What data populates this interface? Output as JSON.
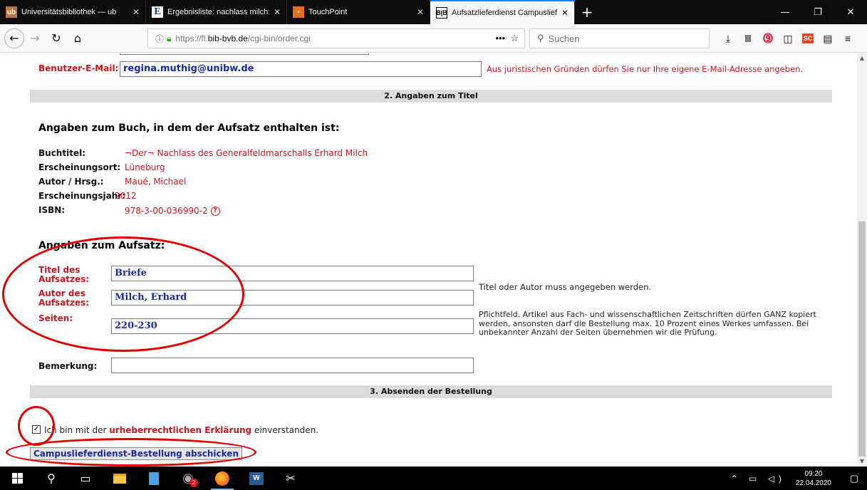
{
  "browser": {
    "tabs": [
      {
        "favicon": "ub",
        "title": "Universitätsbibliothek — ub",
        "active": false
      },
      {
        "favicon": "e",
        "title": "Ergebnisliste: nachlass milch: C",
        "active": false
      },
      {
        "favicon": "touchpoint",
        "title": "TouchPoint",
        "active": false
      },
      {
        "favicon": "bib",
        "title": "Aufsatzlieferdienst Campuslief",
        "active": true
      }
    ],
    "new_tab_icon": "plus-icon",
    "url_prefix": "https://fl.",
    "url_domain": "bib-bvb.de",
    "url_path": "/cgi-bin/order.cgi",
    "url_dots": "•••",
    "search_placeholder": "Suchen",
    "sc_label": "SC"
  },
  "form": {
    "email_label": "Benutzer-E-Mail:",
    "email_value": "regina.muthig@unibw.de",
    "email_note": "Aus juristischen Gründen dürfen Sie nur Ihre eigene E-Mail-Adresse angeben.",
    "section2_title": "2. Angaben zum Titel",
    "book_heading": "Angaben zum Buch, in dem der Aufsatz enthalten ist:",
    "book_fields": [
      {
        "label": "Buchtitel:",
        "value": "¬Der¬ Nachlass des Generalfeldmarschalls Erhard Milch"
      },
      {
        "label": "Erscheinungsort:",
        "value": "Lüneburg"
      },
      {
        "label": "Autor / Hrsg.:",
        "value": "Maué, Michael"
      },
      {
        "label": "Erscheinungsjahr:",
        "value": "2012"
      },
      {
        "label": "ISBN:",
        "value": "978-3-00-036990-2"
      }
    ],
    "isbn_icon_glyph": "?",
    "article_heading": "Angaben zum Aufsatz:",
    "article_title_label_1": "Titel des",
    "article_title_label_2": "Aufsatzes:",
    "article_title_value": "Briefe",
    "article_author_label_1": "Autor des",
    "article_author_label_2": "Aufsatzes:",
    "article_author_value": "Milch, Erhard",
    "title_author_note": "Titel oder Autor muss angegeben werden.",
    "pages_label": "Seiten:",
    "pages_value": "220-230",
    "pages_note": "Pflichtfeld. Artikel aus Fach- und wissenschaftlichen Zeitschriften dürfen GANZ kopiert werden, ansonsten darf die Bestellung max. 10 Prozent eines Werkes umfassen. Bei unbekannter Anzahl der Seiten übernehmen wir die Prüfung.",
    "remark_label": "Bemerkung:",
    "remark_value": "",
    "section3_title": "3. Absenden der Bestellung",
    "consent_prefix": "Ich bin mit der",
    "consent_link": "urheberrechtlichen Erklärung",
    "consent_suffix": "einverstanden.",
    "consent_checked": true,
    "submit_label": "Campuslieferdienst-Bestellung abschicken"
  },
  "taskbar": {
    "firefox_badge": "2",
    "word_label": "W",
    "time": "09:20",
    "date": "22.04.2020"
  },
  "colors": {
    "label_red": "#c8171e",
    "input_blue": "#1a2a9c",
    "annotation_red": "#e00000",
    "section_bar": "#dcdcdc"
  }
}
